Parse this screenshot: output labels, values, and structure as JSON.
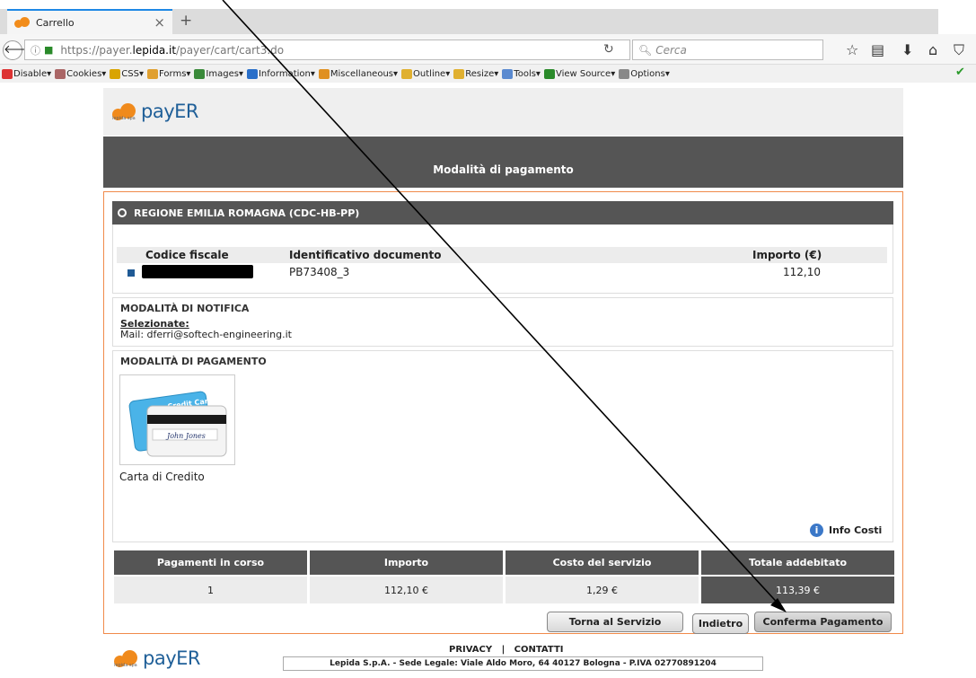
{
  "browser": {
    "tab_title": "Carrello",
    "url_prefix": "https://payer.",
    "url_host": "lepida.it",
    "url_path": "/payer/cart/cart3.do",
    "search_placeholder": "Cerca",
    "devbar": [
      "Disable",
      "Cookies",
      "CSS",
      "Forms",
      "Images",
      "Information",
      "Miscellaneous",
      "Outline",
      "Resize",
      "Tools",
      "View Source",
      "Options"
    ]
  },
  "logo": {
    "small": "lepida spa",
    "word": "payER"
  },
  "page": {
    "title": "Modalità di pagamento",
    "creditor": "REGIONE EMILIA ROMAGNA (CDC-HB-PP)",
    "columns": {
      "fiscal_code": "Codice fiscale",
      "doc_id": "Identificativo documento",
      "amount": "Importo (€)"
    },
    "row": {
      "doc_id": "PB73408_3",
      "amount": "112,10"
    },
    "notif_title": "MODALITÀ DI NOTIFICA",
    "notif_selected": "Selezionate:",
    "notif_mail": "Mail: dferri@softech-engineering.it",
    "pay_title": "MODALITÀ DI PAGAMENTO",
    "card_label": "Carta di Credito",
    "card_text_top": "Credit Card",
    "card_signature": "John Jones",
    "info_costi": "Info Costi"
  },
  "summary": {
    "headers": [
      "Pagamenti in corso",
      "Importo",
      "Costo del servizio",
      "Totale addebitato"
    ],
    "values": [
      "1",
      "112,10 €",
      "1,29 €",
      "113,39 €"
    ]
  },
  "buttons": {
    "torna": "Torna al Servizio",
    "indietro": "Indietro",
    "conferma": "Conferma Pagamento"
  },
  "footer": {
    "links": "PRIVACY   |   CONTATTI",
    "text": "Lepida S.p.A. - Sede Legale: Viale Aldo Moro, 64 40127 Bologna - P.IVA 02770891204"
  },
  "colors": {
    "accent": "#f08a4a",
    "dark_bar": "#555555",
    "logo_blue": "#1f5f98",
    "logo_orange": "#f08a1c"
  }
}
